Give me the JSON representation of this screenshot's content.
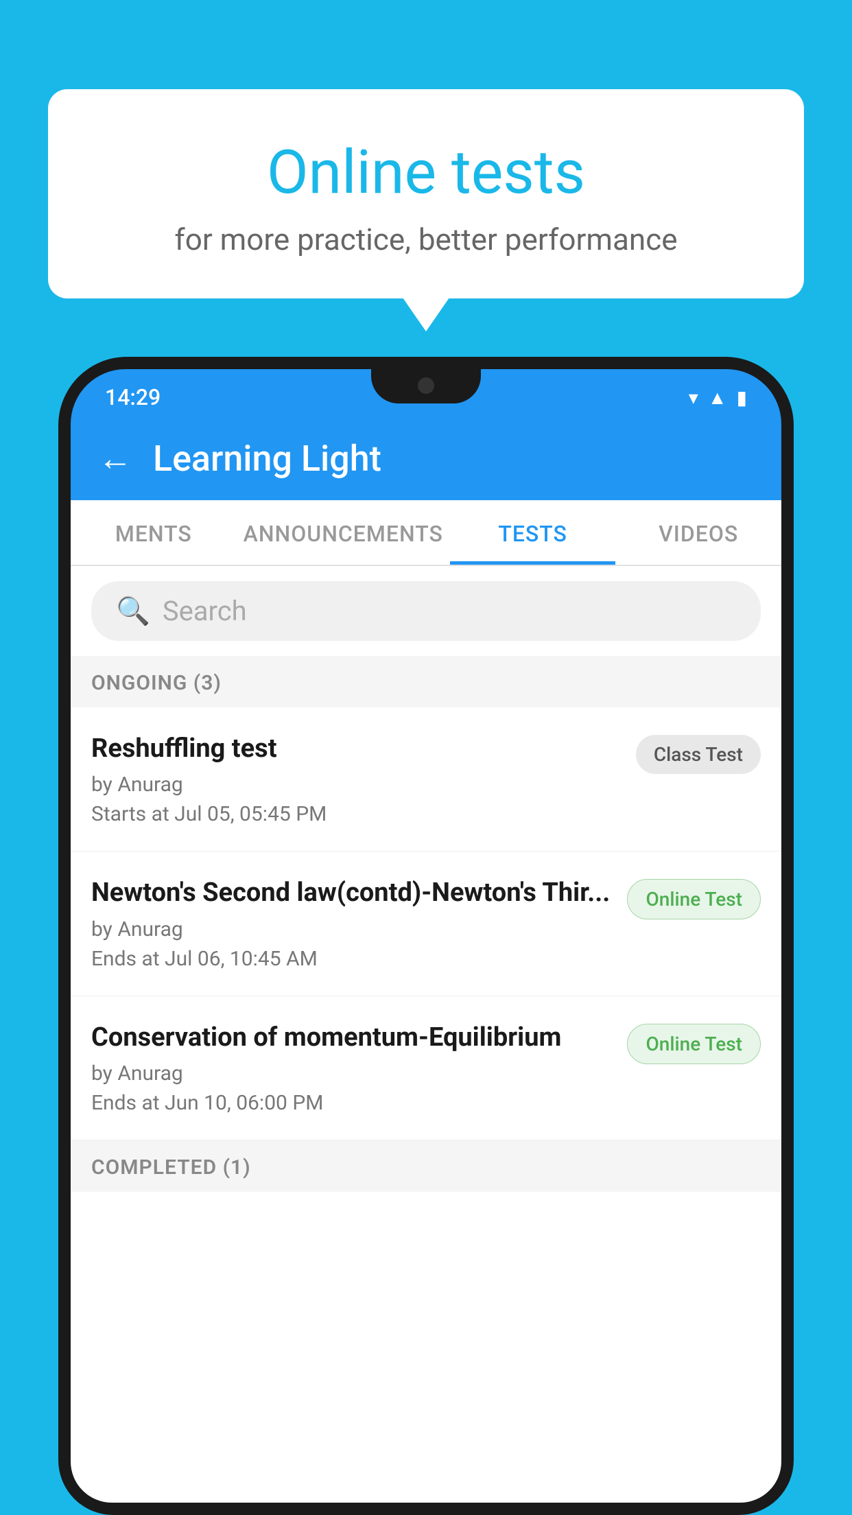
{
  "background_color": "#1ab8e8",
  "bubble": {
    "title": "Online tests",
    "subtitle": "for more practice, better performance"
  },
  "status_bar": {
    "time": "14:29",
    "icons": [
      "wifi",
      "signal",
      "battery"
    ]
  },
  "app_header": {
    "back_label": "←",
    "title": "Learning Light"
  },
  "tabs": [
    {
      "label": "MENTS",
      "active": false
    },
    {
      "label": "ANNOUNCEMENTS",
      "active": false
    },
    {
      "label": "TESTS",
      "active": true
    },
    {
      "label": "VIDEOS",
      "active": false
    }
  ],
  "search": {
    "placeholder": "Search"
  },
  "ongoing_section": {
    "label": "ONGOING (3)"
  },
  "tests": [
    {
      "title": "Reshuffling test",
      "by": "by Anurag",
      "time": "Starts at  Jul 05, 05:45 PM",
      "badge": "Class Test",
      "badge_type": "class"
    },
    {
      "title": "Newton's Second law(contd)-Newton's Thir...",
      "by": "by Anurag",
      "time": "Ends at  Jul 06, 10:45 AM",
      "badge": "Online Test",
      "badge_type": "online"
    },
    {
      "title": "Conservation of momentum-Equilibrium",
      "by": "by Anurag",
      "time": "Ends at  Jun 10, 06:00 PM",
      "badge": "Online Test",
      "badge_type": "online"
    }
  ],
  "completed_section": {
    "label": "COMPLETED (1)"
  }
}
